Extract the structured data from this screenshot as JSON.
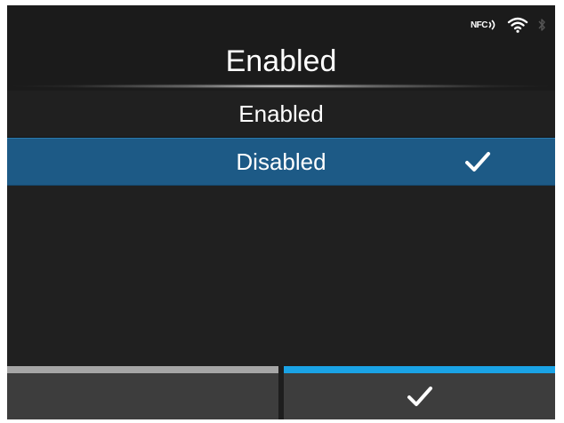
{
  "status_bar": {
    "nfc_label": "NFC",
    "icons": [
      "nfc-icon",
      "wifi-icon",
      "bluetooth-icon"
    ]
  },
  "title": "Enabled",
  "options": [
    {
      "label": "Enabled",
      "selected": false
    },
    {
      "label": "Disabled",
      "selected": true
    }
  ],
  "footer": {
    "left_button_icon": "",
    "right_button_icon": "check-icon"
  },
  "colors": {
    "selection": "#1d5a86",
    "accent": "#1aa3e6",
    "left_indicator": "#a6a6a6",
    "background": "#1e1e1e"
  }
}
